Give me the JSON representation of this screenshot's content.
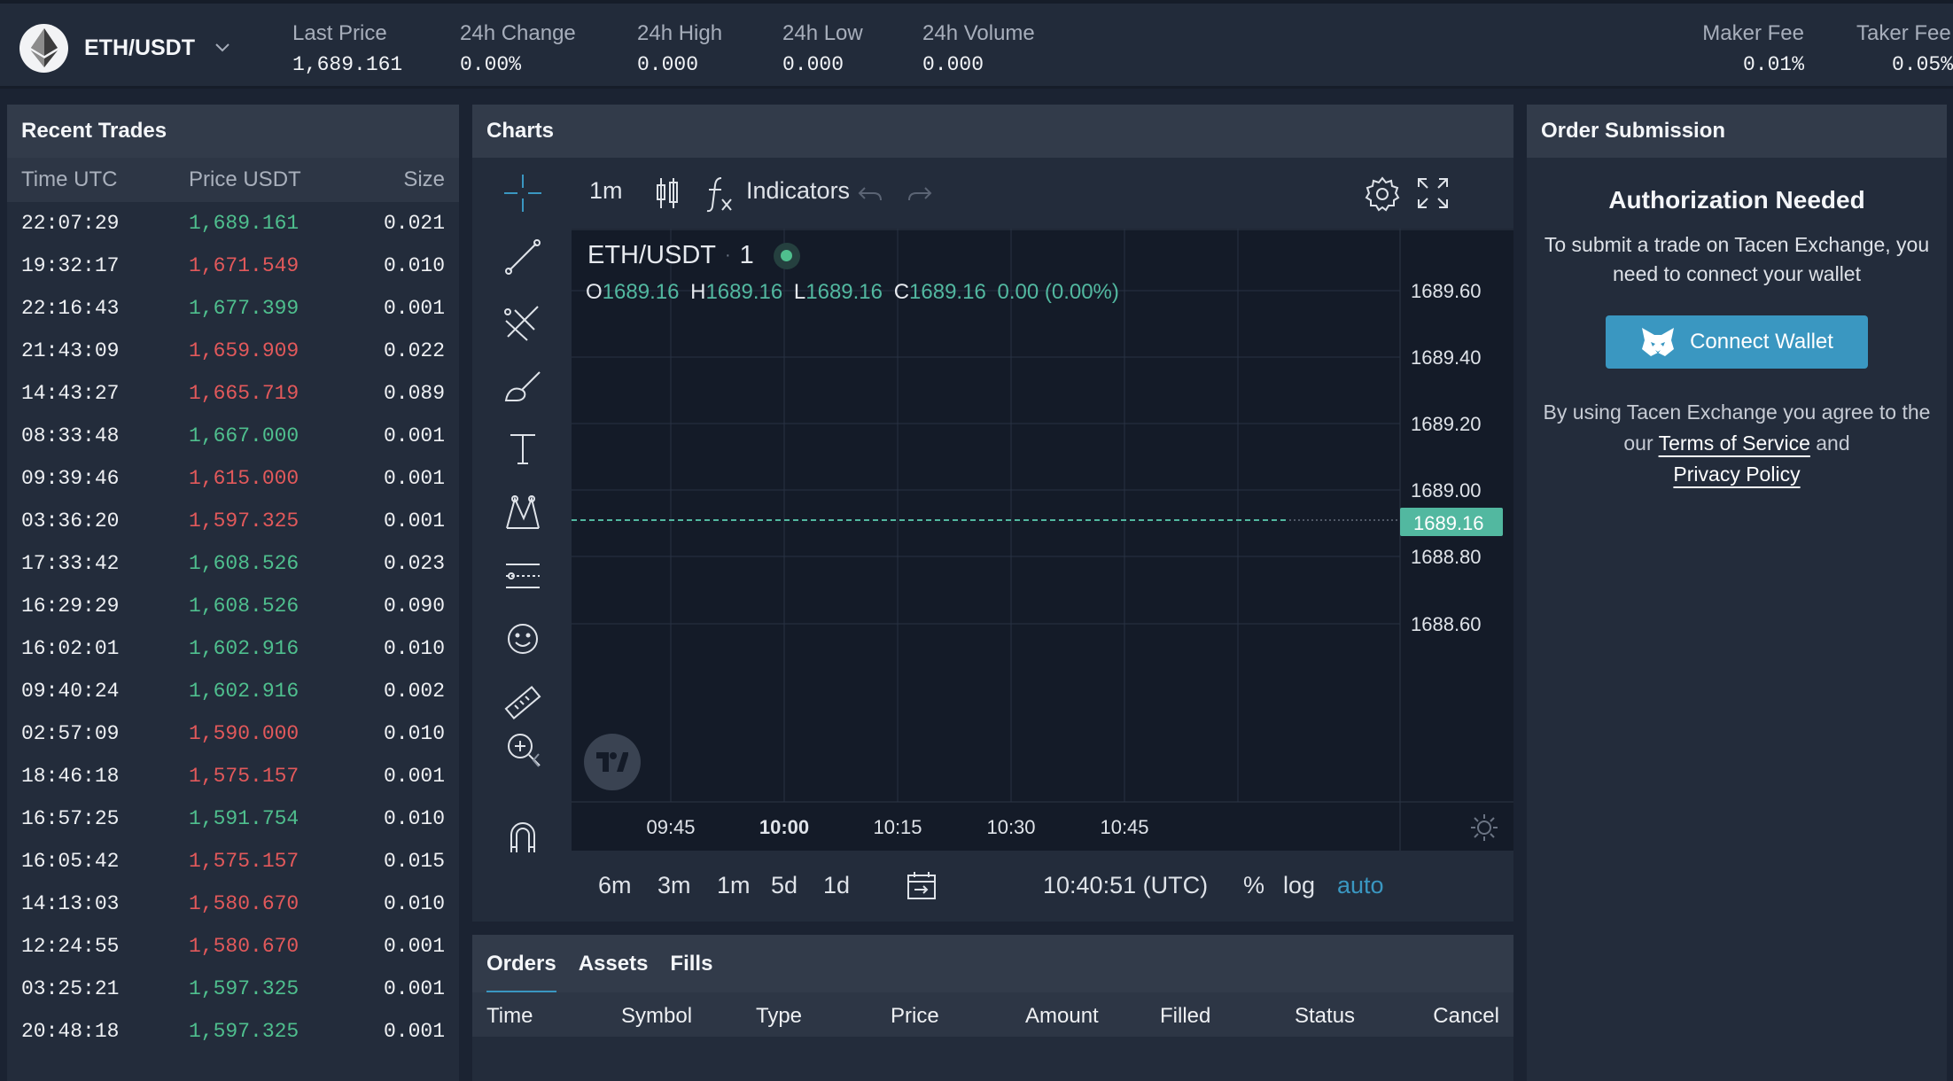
{
  "topbar": {
    "pair": "ETH/USDT",
    "stats": [
      {
        "label": "Last Price",
        "value": "1,689.161"
      },
      {
        "label": "24h Change",
        "value": "0.00%"
      },
      {
        "label": "24h High",
        "value": "0.000"
      },
      {
        "label": "24h Low",
        "value": "0.000"
      },
      {
        "label": "24h Volume",
        "value": "0.000"
      }
    ],
    "fees": [
      {
        "label": "Maker Fee",
        "value": "0.01%"
      },
      {
        "label": "Taker Fee",
        "value": "0.05%"
      }
    ]
  },
  "recent_trades": {
    "title": "Recent Trades",
    "columns": [
      "Time UTC",
      "Price USDT",
      "Size"
    ],
    "rows": [
      {
        "time": "22:07:29",
        "price": "1,689.161",
        "size": "0.021",
        "side": "buy"
      },
      {
        "time": "19:32:17",
        "price": "1,671.549",
        "size": "0.010",
        "side": "sell"
      },
      {
        "time": "22:16:43",
        "price": "1,677.399",
        "size": "0.001",
        "side": "buy"
      },
      {
        "time": "21:43:09",
        "price": "1,659.909",
        "size": "0.022",
        "side": "sell"
      },
      {
        "time": "14:43:27",
        "price": "1,665.719",
        "size": "0.089",
        "side": "sell"
      },
      {
        "time": "08:33:48",
        "price": "1,667.000",
        "size": "0.001",
        "side": "buy"
      },
      {
        "time": "09:39:46",
        "price": "1,615.000",
        "size": "0.001",
        "side": "sell"
      },
      {
        "time": "03:36:20",
        "price": "1,597.325",
        "size": "0.001",
        "side": "sell"
      },
      {
        "time": "17:33:42",
        "price": "1,608.526",
        "size": "0.023",
        "side": "buy"
      },
      {
        "time": "16:29:29",
        "price": "1,608.526",
        "size": "0.090",
        "side": "buy"
      },
      {
        "time": "16:02:01",
        "price": "1,602.916",
        "size": "0.010",
        "side": "buy"
      },
      {
        "time": "09:40:24",
        "price": "1,602.916",
        "size": "0.002",
        "side": "buy"
      },
      {
        "time": "02:57:09",
        "price": "1,590.000",
        "size": "0.010",
        "side": "sell"
      },
      {
        "time": "18:46:18",
        "price": "1,575.157",
        "size": "0.001",
        "side": "sell"
      },
      {
        "time": "16:57:25",
        "price": "1,591.754",
        "size": "0.010",
        "side": "buy"
      },
      {
        "time": "16:05:42",
        "price": "1,575.157",
        "size": "0.015",
        "side": "sell"
      },
      {
        "time": "14:13:03",
        "price": "1,580.670",
        "size": "0.010",
        "side": "sell"
      },
      {
        "time": "12:24:55",
        "price": "1,580.670",
        "size": "0.001",
        "side": "sell"
      },
      {
        "time": "03:25:21",
        "price": "1,597.325",
        "size": "0.001",
        "side": "buy"
      },
      {
        "time": "20:48:18",
        "price": "1,597.325",
        "size": "0.001",
        "side": "buy"
      }
    ]
  },
  "charts": {
    "title": "Charts",
    "interval": "1m",
    "indicators_label": "Indicators",
    "legend_symbol": "ETH/USDT",
    "legend_interval": "1",
    "ohlc": {
      "o": "1689.16",
      "h": "1689.16",
      "l": "1689.16",
      "c": "1689.16",
      "change": "0.00 (0.00%)"
    },
    "price_ticks": [
      "1689.60",
      "1689.40",
      "1689.20",
      "1689.00",
      "1688.80",
      "1688.60"
    ],
    "current_price_label": "1689.16",
    "time_ticks": [
      "09:45",
      "10:00",
      "10:15",
      "10:30",
      "10:45"
    ],
    "ranges": [
      "6m",
      "3m",
      "1m",
      "5d",
      "1d"
    ],
    "clock": "10:40:51 (UTC)",
    "scale_options": [
      "%",
      "log",
      "auto"
    ],
    "colors": {
      "up": "#4fbf8e",
      "down": "#e2595b",
      "accent": "#3a97c1",
      "price_line": "#52b8a0"
    }
  },
  "order_submission": {
    "title": "Order Submission",
    "auth_title": "Authorization Needed",
    "auth_message": "To submit a trade on Tacen Exchange, you need to connect your wallet",
    "connect_label": "Connect Wallet",
    "agree_prefix": "By using Tacen Exchange you agree to the our",
    "terms_label": "Terms of Service",
    "and_label": "and",
    "privacy_label": "Privacy Policy"
  },
  "orders": {
    "tabs": [
      "Orders",
      "Assets",
      "Fills"
    ],
    "columns": [
      "Time",
      "Symbol",
      "Type",
      "Price",
      "Amount",
      "Filled",
      "Status",
      "Cancel"
    ]
  }
}
